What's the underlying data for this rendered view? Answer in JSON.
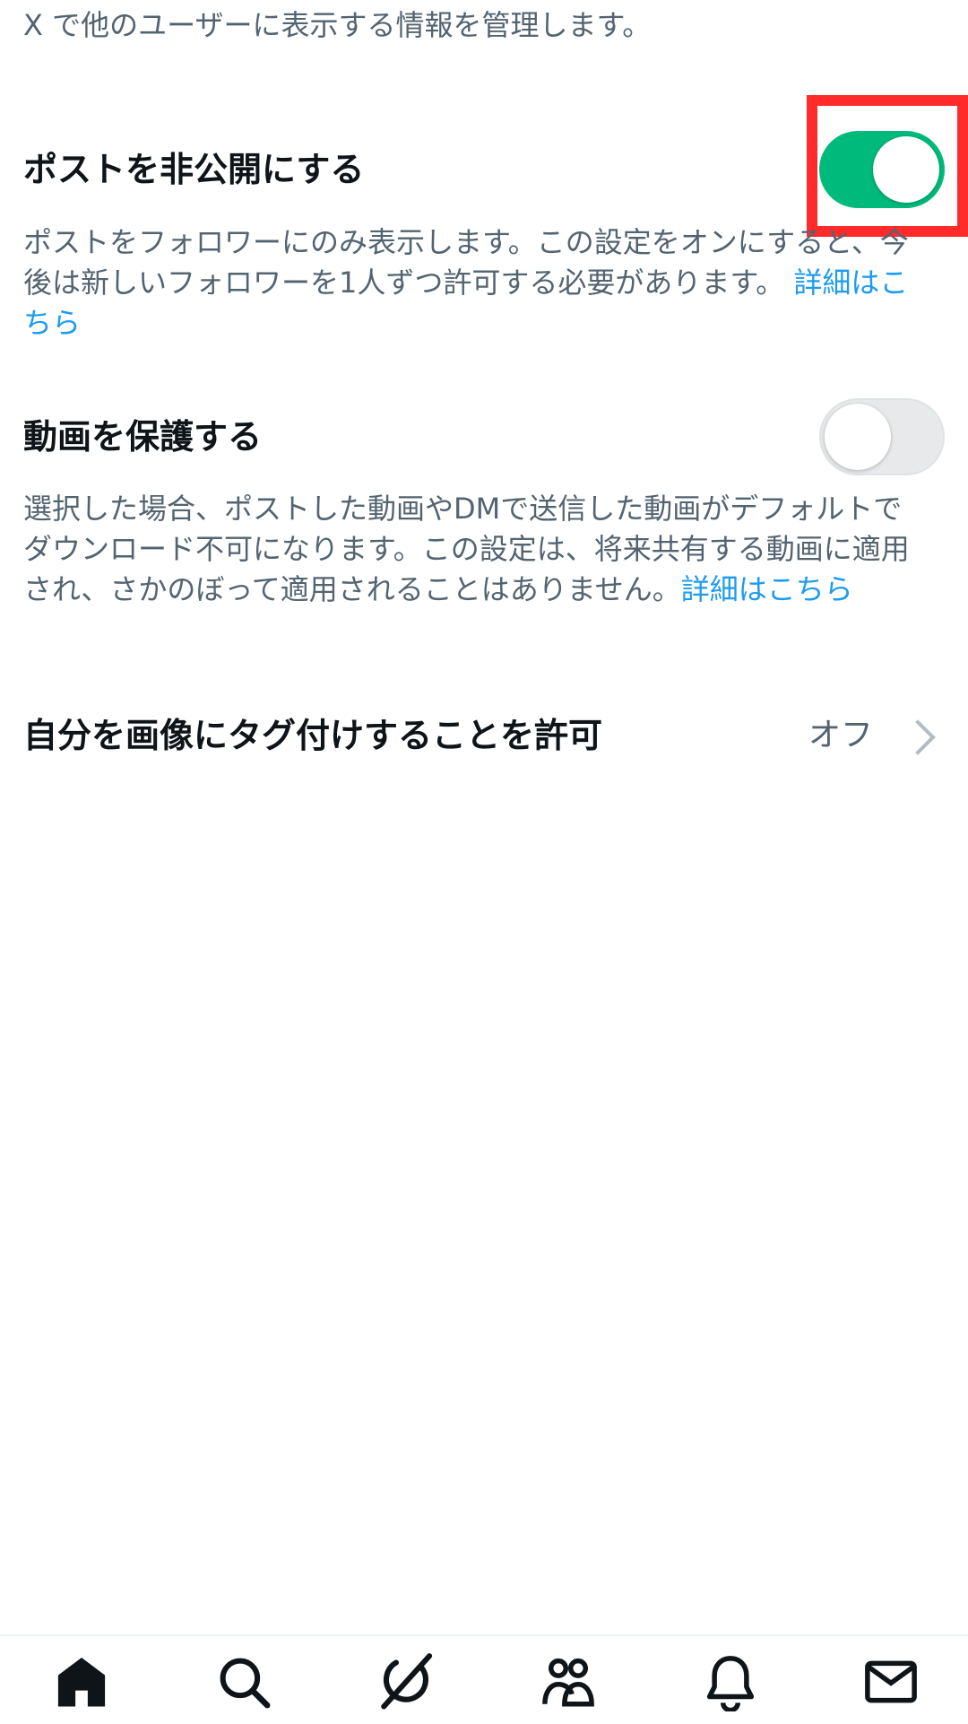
{
  "intro_text": "X で他のユーザーに表示する情報を管理します。",
  "settings": {
    "protect_posts": {
      "title": "ポストを非公開にする",
      "desc": "ポストをフォロワーにのみ表示します。この設定をオンにすると、今後は新しいフォロワーを1人ずつ許可する必要があります。",
      "link": "詳細はこちら",
      "enabled": true
    },
    "protect_videos": {
      "title": "動画を保護する",
      "desc": "選択した場合、ポストした動画やDMで送信した動画がデフォルトでダウンロード不可になります。この設定は、将来共有する動画に適用され、さかのぼって適用されることはありません。",
      "link": "詳細はこちら",
      "enabled": false
    },
    "photo_tagging": {
      "title": "自分を画像にタグ付けすることを許可",
      "value": "オフ"
    }
  },
  "colors": {
    "toggle_on": "#00ba7c",
    "toggle_off": "#e7e9ea",
    "link": "#1d9bf0",
    "highlight": "#ff2b2b"
  },
  "bottom_nav": {
    "icons": [
      "home-icon",
      "search-icon",
      "grok-icon",
      "communities-icon",
      "notifications-icon",
      "messages-icon"
    ]
  }
}
